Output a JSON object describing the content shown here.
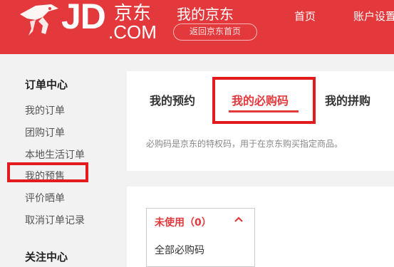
{
  "header": {
    "logo_text": "JD",
    "logo_cn": "京东",
    "logo_com": ".COM",
    "page_title": "我的京东",
    "back_home": "返回京东首页",
    "nav": [
      "首页",
      "账户设置"
    ]
  },
  "sidebar": {
    "section1_title": "订单中心",
    "items": [
      "我的订单",
      "团购订单",
      "本地生活订单",
      "我的预售",
      "评价晒单",
      "取消订单记录"
    ],
    "section2_title": "关注中心"
  },
  "tabs": [
    "我的预约",
    "我的必购码",
    "我的拼购"
  ],
  "active_tab": "我的必购码",
  "description": "必购码是京东的特权码，用于在京东购买指定商品。",
  "dropdown": {
    "selected": "未使用（0）",
    "options": [
      "全部必购码"
    ]
  },
  "colors": {
    "brand_red": "#e4393c",
    "highlight_red": "#e31b1f"
  }
}
